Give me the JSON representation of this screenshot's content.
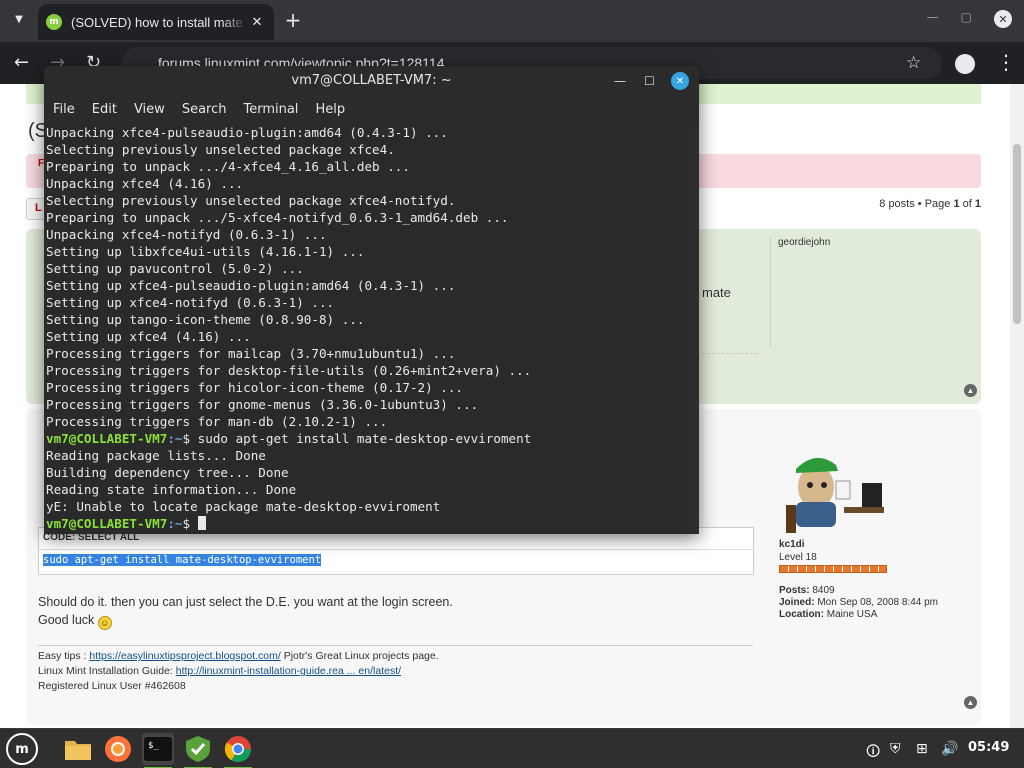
{
  "browser": {
    "tab_title": "(SOLVED) how to install mate",
    "new_tab": "+",
    "url": "forums.linuxmint.com/viewtopic.php?t=128114"
  },
  "forum": {
    "title": "(S",
    "alert": "F",
    "pag_btn": "L",
    "posts_count": {
      "prefix": "8 posts • Page ",
      "page": "1",
      "of": " of ",
      "total": "1"
    },
    "post1": {
      "author": "geordiejohn",
      "snippet": "mate"
    },
    "post2": {
      "code_label": "CODE: SELECT ALL",
      "code": "sudo apt-get install mate-desktop-evviroment",
      "text1": "Should do it. then you can just select the D.E. you want at the login screen.",
      "text2": "Good luck",
      "sig_easy_prefix": "Easy tips : ",
      "sig_easy_link": "https://easylinuxtipsproject.blogspot.com/",
      "sig_easy_suffix": " Pjotr's Great Linux projects page.",
      "sig_guide_prefix": "Linux Mint Installation Guide: ",
      "sig_guide_link": "http://linuxmint-installation-guide.rea ... en/latest/",
      "sig_user": "Registered Linux User #462608"
    },
    "user": {
      "name": "kc1di",
      "level": "Level 18",
      "posts_label": "Posts:",
      "posts": "8409",
      "joined_label": "Joined:",
      "joined": "Mon Sep 08, 2008 8:44 pm",
      "location_label": "Location:",
      "location": "Maine USA"
    }
  },
  "terminal": {
    "title": "vm7@COLLABET-VM7: ~",
    "menu": [
      "File",
      "Edit",
      "View",
      "Search",
      "Terminal",
      "Help"
    ],
    "lines": [
      "Unpacking xfce4-pulseaudio-plugin:amd64 (0.4.3-1) ...",
      "Selecting previously unselected package xfce4.",
      "Preparing to unpack .../4-xfce4_4.16_all.deb ...",
      "Unpacking xfce4 (4.16) ...",
      "Selecting previously unselected package xfce4-notifyd.",
      "Preparing to unpack .../5-xfce4-notifyd_0.6.3-1_amd64.deb ...",
      "Unpacking xfce4-notifyd (0.6.3-1) ...",
      "Setting up libxfce4ui-utils (4.16.1-1) ...",
      "Setting up pavucontrol (5.0-2) ...",
      "Setting up xfce4-pulseaudio-plugin:amd64 (0.4.3-1) ...",
      "Setting up xfce4-notifyd (0.6.3-1) ...",
      "Setting up tango-icon-theme (0.8.90-8) ...",
      "Setting up xfce4 (4.16) ...",
      "Processing triggers for mailcap (3.70+nmu1ubuntu1) ...",
      "Processing triggers for desktop-file-utils (0.26+mint2+vera) ...",
      "Processing triggers for hicolor-icon-theme (0.17-2) ...",
      "Processing triggers for gnome-menus (3.36.0-1ubuntu3) ...",
      "Processing triggers for man-db (2.10.2-1) ..."
    ],
    "prompt_user": "vm7@COLLABET-VM7",
    "prompt_path": ":~",
    "prompt_sign": "$ ",
    "command": "sudo apt-get install mate-desktop-evviroment",
    "output": [
      "Reading package lists... Done",
      "Building dependency tree... Done",
      "Reading state information... Done",
      "E: Unable to locate package mate-desktop-evviroment"
    ],
    "output_prefix": "y"
  },
  "taskbar": {
    "clock": "05:49"
  },
  "colors": {
    "prompt_green": "#8ae234",
    "prompt_blue": "#729fcf",
    "mint_green": "#87cf3e"
  }
}
